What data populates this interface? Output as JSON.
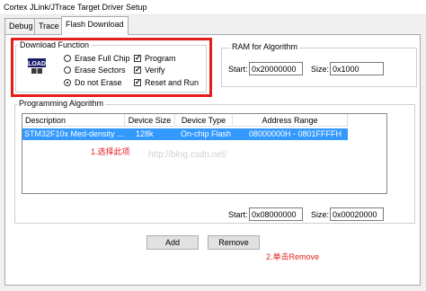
{
  "window": {
    "title": "Cortex JLink/JTrace Target Driver Setup"
  },
  "tabs": [
    {
      "label": "Debug"
    },
    {
      "label": "Trace"
    },
    {
      "label": "Flash Download"
    }
  ],
  "download_function": {
    "group_label": "Download Function",
    "icon": "load-icon",
    "radios": [
      {
        "label": "Erase Full Chip",
        "selected": false
      },
      {
        "label": "Erase Sectors",
        "selected": false
      },
      {
        "label": "Do not Erase",
        "selected": true
      }
    ],
    "checks": [
      {
        "label": "Program",
        "checked": true
      },
      {
        "label": "Verify",
        "checked": true
      },
      {
        "label": "Reset and Run",
        "checked": true
      }
    ]
  },
  "ram": {
    "group_label": "RAM for Algorithm",
    "start_label": "Start:",
    "start_value": "0x20000000",
    "size_label": "Size:",
    "size_value": "0x1000"
  },
  "programming": {
    "group_label": "Programming Algorithm",
    "columns": [
      "Description",
      "Device Size",
      "Device Type",
      "Address Range"
    ],
    "rows": [
      {
        "description": "STM32F10x Med-density ...",
        "size": "128k",
        "type": "On-chip Flash",
        "range": "08000000H - 0801FFFFH"
      }
    ],
    "start_label": "Start:",
    "start_value": "0x08000000",
    "size_label": "Size:",
    "size_value": "0x00020000"
  },
  "buttons": {
    "add": "Add",
    "remove": "Remove"
  },
  "annotations": {
    "select_item": "1.选择此项",
    "click_remove": "2.单击Remove"
  },
  "watermark": "http://blog.csdn.net/",
  "colors": {
    "annotation": "#e51c1c",
    "selection": "#3399ff"
  }
}
